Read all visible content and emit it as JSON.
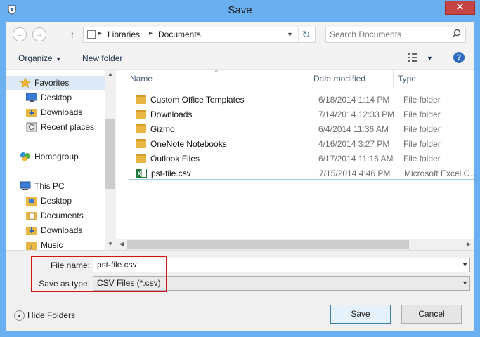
{
  "window": {
    "title": "Save",
    "close_glyph": "✕"
  },
  "nav": {
    "back_glyph": "←",
    "forward_glyph": "→",
    "up_glyph": "↑"
  },
  "address": {
    "crumbs": [
      "Libraries",
      "Documents"
    ],
    "separator": "▸",
    "refresh_glyph": "↻"
  },
  "search": {
    "placeholder": "Search Documents",
    "icon": "search-icon"
  },
  "toolbar": {
    "organize_label": "Organize",
    "new_folder_label": "New folder",
    "help_label": "?"
  },
  "sidebar": {
    "items": [
      {
        "label": "Favorites",
        "icon": "star-icon",
        "color": "#f2b632"
      },
      {
        "label": "Desktop",
        "icon": "desktop-icon",
        "color": "#3a7bd5"
      },
      {
        "label": "Downloads",
        "icon": "downloads-folder-icon",
        "color": "#e8b642"
      },
      {
        "label": "Recent places",
        "icon": "recent-places-icon",
        "color": "#8a8a8a"
      },
      {
        "label": "Homegroup",
        "icon": "homegroup-icon",
        "color": "#2f8fd8"
      },
      {
        "label": "This PC",
        "icon": "computer-icon",
        "color": "#3a7bd5"
      },
      {
        "label": "Desktop",
        "icon": "desktop-folder-icon",
        "color": "#e8b642"
      },
      {
        "label": "Documents",
        "icon": "documents-folder-icon",
        "color": "#e8b642"
      },
      {
        "label": "Downloads",
        "icon": "downloads-folder-icon",
        "color": "#e8b642"
      },
      {
        "label": "Music",
        "icon": "music-folder-icon",
        "color": "#e8b642"
      }
    ]
  },
  "filelist": {
    "columns": [
      "Name",
      "Date modified",
      "Type"
    ],
    "rows": [
      {
        "name": "Custom Office Templates",
        "date": "6/18/2014 1:14 PM",
        "type": "File folder",
        "icon": "folder-icon"
      },
      {
        "name": "Downloads",
        "date": "7/14/2014 12:33 PM",
        "type": "File folder",
        "icon": "folder-icon"
      },
      {
        "name": "Gizmo",
        "date": "6/4/2014 11:36 AM",
        "type": "File folder",
        "icon": "folder-icon"
      },
      {
        "name": "OneNote Notebooks",
        "date": "4/16/2014 3:27 PM",
        "type": "File folder",
        "icon": "folder-icon"
      },
      {
        "name": "Outlook Files",
        "date": "6/17/2014 11:16 AM",
        "type": "File folder",
        "icon": "folder-icon"
      },
      {
        "name": "pst-file.csv",
        "date": "7/15/2014 4:46 PM",
        "type": "Microsoft Excel C...",
        "icon": "excel-csv-icon"
      }
    ]
  },
  "form": {
    "file_name_label": "File name:",
    "file_name_value": "pst-file.csv",
    "save_type_label": "Save as type:",
    "save_type_value": "CSV Files (*.csv)"
  },
  "footer": {
    "hide_folders_label": "Hide Folders",
    "save_label": "Save",
    "cancel_label": "Cancel"
  },
  "colors": {
    "title_bar": "#6aaff0",
    "close_button": "#c74444",
    "highlight_box": "#d01515",
    "folder": "#e8b642"
  }
}
